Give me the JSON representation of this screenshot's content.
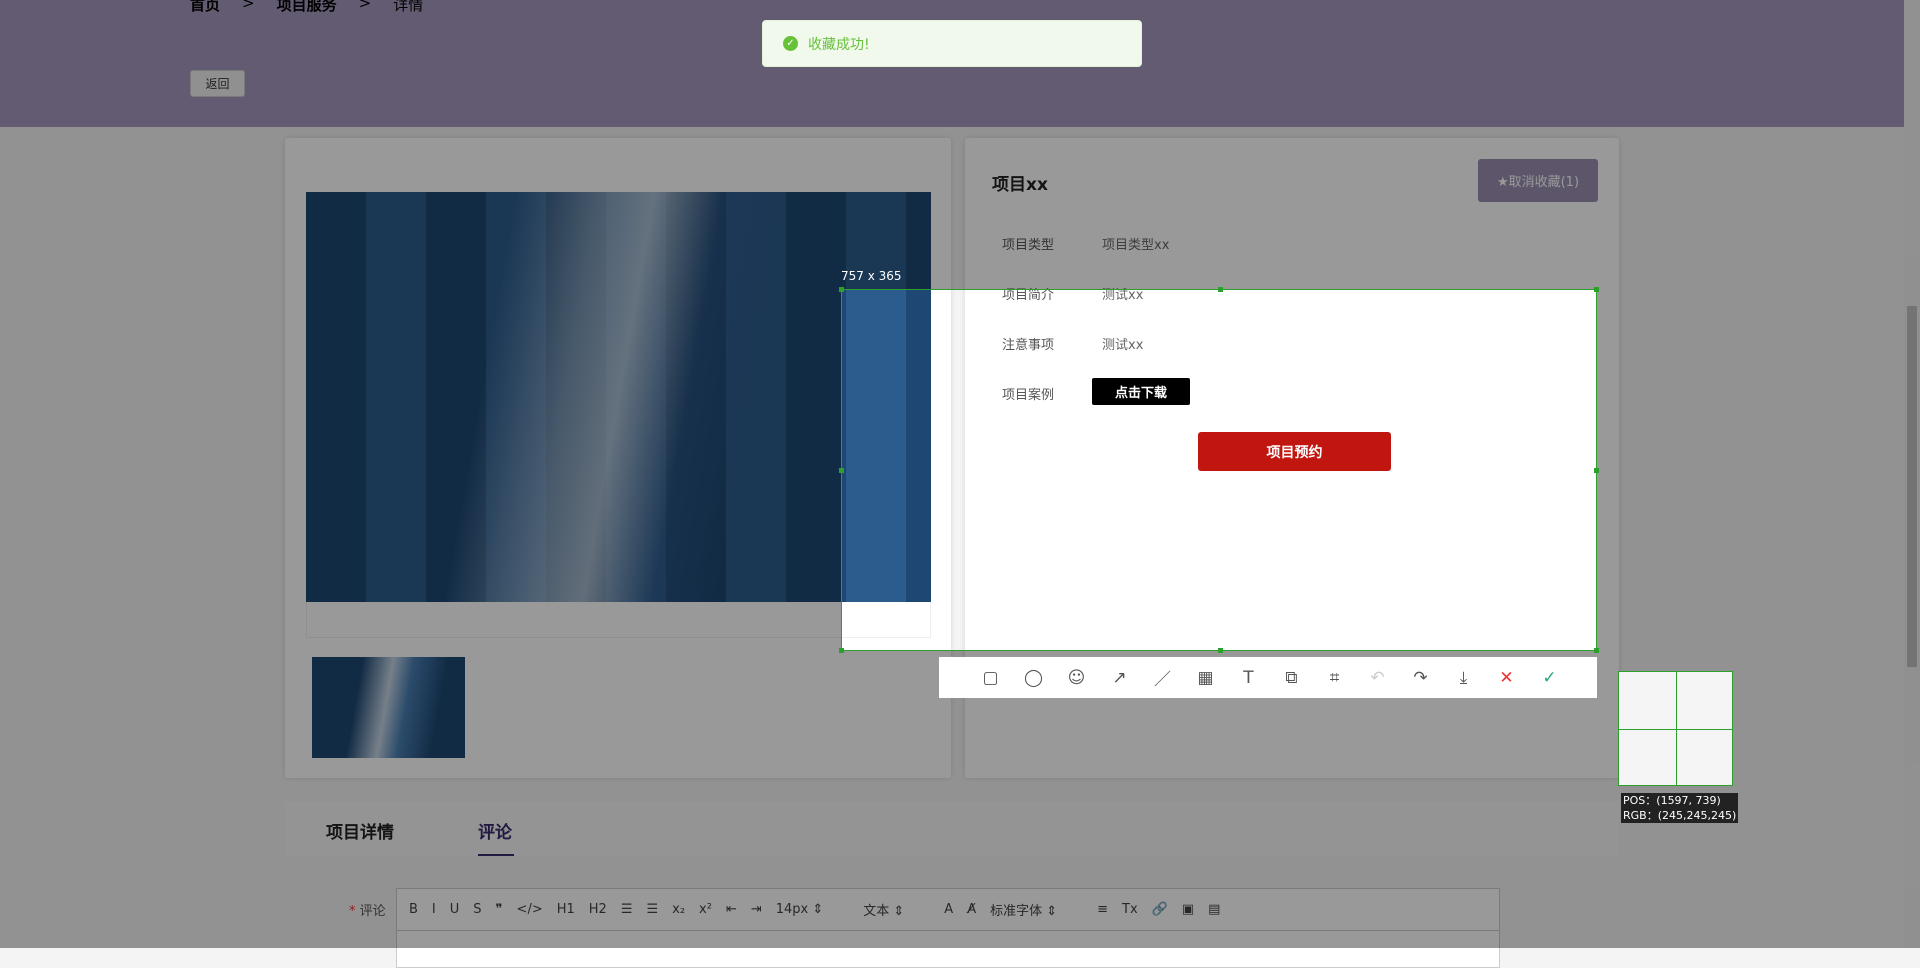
{
  "breadcrumb": [
    "首页",
    ">",
    "项目服务",
    ">",
    "详情"
  ],
  "back_label": "返回",
  "toast": {
    "icon": "check-circle-icon",
    "text": "收藏成功!",
    "color": "#67c23a"
  },
  "project": {
    "title": "项目xx",
    "favorite_label": "★取消收藏(1)",
    "rows": [
      {
        "label": "项目类型",
        "value": "项目类型xx"
      },
      {
        "label": "项目简介",
        "value": "测试xx"
      },
      {
        "label": "注意事项",
        "value": "测试xx"
      },
      {
        "label": "项目案例",
        "value": "点击下载"
      }
    ],
    "reserve_label": "项目预约"
  },
  "tabs": [
    {
      "label": "项目详情"
    },
    {
      "label": "评论",
      "active": true
    }
  ],
  "comment": {
    "label": "评论",
    "required_mark": "*",
    "toolbar": [
      "B",
      "I",
      "U",
      "S",
      "❞",
      "</>",
      "H1",
      "H2",
      "☰",
      "☰",
      "x₂",
      "x²",
      "⇤",
      "⇥",
      "14px ⇕",
      "文本 ⇕",
      "A",
      "A̸",
      "标准字体 ⇕",
      "≡",
      "Tx",
      "🔗",
      "▣",
      "▤"
    ]
  },
  "screenshot_tool": {
    "size_label": "757 x 365",
    "tools": [
      "rectangle-icon",
      "circle-icon",
      "emoji-icon",
      "arrow-icon",
      "pen-icon",
      "mosaic-icon",
      "text-icon",
      "copy-icon",
      "ocr-icon",
      "undo-icon",
      "share-icon",
      "save-icon",
      "cancel-icon",
      "confirm-icon"
    ],
    "tool_glyphs": [
      "▢",
      "◯",
      "☺",
      "↗",
      "／",
      "▦",
      "T",
      "⧉",
      "⌗",
      "↶",
      "↷",
      "⤓",
      "✕",
      "✓"
    ],
    "pos": "POS：(1597, 739)",
    "rgb": "RGB：(245,245,245)"
  },
  "colors": {
    "accent": "#3a2c6c",
    "reserve": "#c0160f",
    "selection": "#2ca02c"
  }
}
